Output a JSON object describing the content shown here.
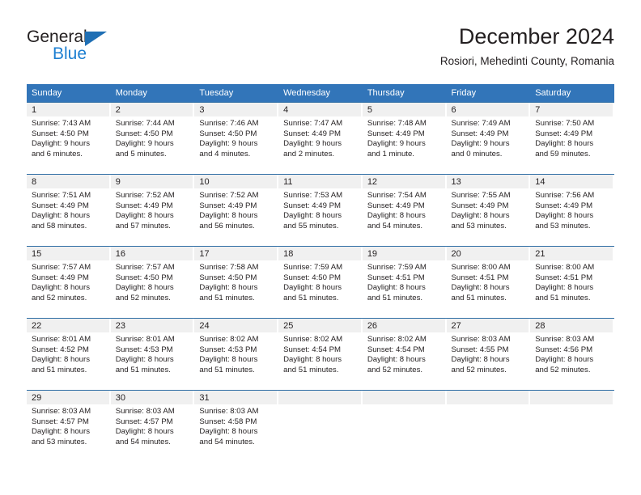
{
  "brand": {
    "name_top": "General",
    "name_bottom": "Blue",
    "accent_color": "#1d7fd1",
    "triangle_color": "#1f6fb4"
  },
  "header": {
    "title": "December 2024",
    "subtitle": "Rosiori, Mehedinti County, Romania"
  },
  "calendar": {
    "header_bg": "#3275b9",
    "row_divider_color": "#2e6da4",
    "daynum_bg": "#f0f0f0",
    "weekdays": [
      "Sunday",
      "Monday",
      "Tuesday",
      "Wednesday",
      "Thursday",
      "Friday",
      "Saturday"
    ],
    "weeks": [
      [
        {
          "day": "1",
          "sunrise": "Sunrise: 7:43 AM",
          "sunset": "Sunset: 4:50 PM",
          "daylight_1": "Daylight: 9 hours",
          "daylight_2": "and 6 minutes."
        },
        {
          "day": "2",
          "sunrise": "Sunrise: 7:44 AM",
          "sunset": "Sunset: 4:50 PM",
          "daylight_1": "Daylight: 9 hours",
          "daylight_2": "and 5 minutes."
        },
        {
          "day": "3",
          "sunrise": "Sunrise: 7:46 AM",
          "sunset": "Sunset: 4:50 PM",
          "daylight_1": "Daylight: 9 hours",
          "daylight_2": "and 4 minutes."
        },
        {
          "day": "4",
          "sunrise": "Sunrise: 7:47 AM",
          "sunset": "Sunset: 4:49 PM",
          "daylight_1": "Daylight: 9 hours",
          "daylight_2": "and 2 minutes."
        },
        {
          "day": "5",
          "sunrise": "Sunrise: 7:48 AM",
          "sunset": "Sunset: 4:49 PM",
          "daylight_1": "Daylight: 9 hours",
          "daylight_2": "and 1 minute."
        },
        {
          "day": "6",
          "sunrise": "Sunrise: 7:49 AM",
          "sunset": "Sunset: 4:49 PM",
          "daylight_1": "Daylight: 9 hours",
          "daylight_2": "and 0 minutes."
        },
        {
          "day": "7",
          "sunrise": "Sunrise: 7:50 AM",
          "sunset": "Sunset: 4:49 PM",
          "daylight_1": "Daylight: 8 hours",
          "daylight_2": "and 59 minutes."
        }
      ],
      [
        {
          "day": "8",
          "sunrise": "Sunrise: 7:51 AM",
          "sunset": "Sunset: 4:49 PM",
          "daylight_1": "Daylight: 8 hours",
          "daylight_2": "and 58 minutes."
        },
        {
          "day": "9",
          "sunrise": "Sunrise: 7:52 AM",
          "sunset": "Sunset: 4:49 PM",
          "daylight_1": "Daylight: 8 hours",
          "daylight_2": "and 57 minutes."
        },
        {
          "day": "10",
          "sunrise": "Sunrise: 7:52 AM",
          "sunset": "Sunset: 4:49 PM",
          "daylight_1": "Daylight: 8 hours",
          "daylight_2": "and 56 minutes."
        },
        {
          "day": "11",
          "sunrise": "Sunrise: 7:53 AM",
          "sunset": "Sunset: 4:49 PM",
          "daylight_1": "Daylight: 8 hours",
          "daylight_2": "and 55 minutes."
        },
        {
          "day": "12",
          "sunrise": "Sunrise: 7:54 AM",
          "sunset": "Sunset: 4:49 PM",
          "daylight_1": "Daylight: 8 hours",
          "daylight_2": "and 54 minutes."
        },
        {
          "day": "13",
          "sunrise": "Sunrise: 7:55 AM",
          "sunset": "Sunset: 4:49 PM",
          "daylight_1": "Daylight: 8 hours",
          "daylight_2": "and 53 minutes."
        },
        {
          "day": "14",
          "sunrise": "Sunrise: 7:56 AM",
          "sunset": "Sunset: 4:49 PM",
          "daylight_1": "Daylight: 8 hours",
          "daylight_2": "and 53 minutes."
        }
      ],
      [
        {
          "day": "15",
          "sunrise": "Sunrise: 7:57 AM",
          "sunset": "Sunset: 4:49 PM",
          "daylight_1": "Daylight: 8 hours",
          "daylight_2": "and 52 minutes."
        },
        {
          "day": "16",
          "sunrise": "Sunrise: 7:57 AM",
          "sunset": "Sunset: 4:50 PM",
          "daylight_1": "Daylight: 8 hours",
          "daylight_2": "and 52 minutes."
        },
        {
          "day": "17",
          "sunrise": "Sunrise: 7:58 AM",
          "sunset": "Sunset: 4:50 PM",
          "daylight_1": "Daylight: 8 hours",
          "daylight_2": "and 51 minutes."
        },
        {
          "day": "18",
          "sunrise": "Sunrise: 7:59 AM",
          "sunset": "Sunset: 4:50 PM",
          "daylight_1": "Daylight: 8 hours",
          "daylight_2": "and 51 minutes."
        },
        {
          "day": "19",
          "sunrise": "Sunrise: 7:59 AM",
          "sunset": "Sunset: 4:51 PM",
          "daylight_1": "Daylight: 8 hours",
          "daylight_2": "and 51 minutes."
        },
        {
          "day": "20",
          "sunrise": "Sunrise: 8:00 AM",
          "sunset": "Sunset: 4:51 PM",
          "daylight_1": "Daylight: 8 hours",
          "daylight_2": "and 51 minutes."
        },
        {
          "day": "21",
          "sunrise": "Sunrise: 8:00 AM",
          "sunset": "Sunset: 4:51 PM",
          "daylight_1": "Daylight: 8 hours",
          "daylight_2": "and 51 minutes."
        }
      ],
      [
        {
          "day": "22",
          "sunrise": "Sunrise: 8:01 AM",
          "sunset": "Sunset: 4:52 PM",
          "daylight_1": "Daylight: 8 hours",
          "daylight_2": "and 51 minutes."
        },
        {
          "day": "23",
          "sunrise": "Sunrise: 8:01 AM",
          "sunset": "Sunset: 4:53 PM",
          "daylight_1": "Daylight: 8 hours",
          "daylight_2": "and 51 minutes."
        },
        {
          "day": "24",
          "sunrise": "Sunrise: 8:02 AM",
          "sunset": "Sunset: 4:53 PM",
          "daylight_1": "Daylight: 8 hours",
          "daylight_2": "and 51 minutes."
        },
        {
          "day": "25",
          "sunrise": "Sunrise: 8:02 AM",
          "sunset": "Sunset: 4:54 PM",
          "daylight_1": "Daylight: 8 hours",
          "daylight_2": "and 51 minutes."
        },
        {
          "day": "26",
          "sunrise": "Sunrise: 8:02 AM",
          "sunset": "Sunset: 4:54 PM",
          "daylight_1": "Daylight: 8 hours",
          "daylight_2": "and 52 minutes."
        },
        {
          "day": "27",
          "sunrise": "Sunrise: 8:03 AM",
          "sunset": "Sunset: 4:55 PM",
          "daylight_1": "Daylight: 8 hours",
          "daylight_2": "and 52 minutes."
        },
        {
          "day": "28",
          "sunrise": "Sunrise: 8:03 AM",
          "sunset": "Sunset: 4:56 PM",
          "daylight_1": "Daylight: 8 hours",
          "daylight_2": "and 52 minutes."
        }
      ],
      [
        {
          "day": "29",
          "sunrise": "Sunrise: 8:03 AM",
          "sunset": "Sunset: 4:57 PM",
          "daylight_1": "Daylight: 8 hours",
          "daylight_2": "and 53 minutes."
        },
        {
          "day": "30",
          "sunrise": "Sunrise: 8:03 AM",
          "sunset": "Sunset: 4:57 PM",
          "daylight_1": "Daylight: 8 hours",
          "daylight_2": "and 54 minutes."
        },
        {
          "day": "31",
          "sunrise": "Sunrise: 8:03 AM",
          "sunset": "Sunset: 4:58 PM",
          "daylight_1": "Daylight: 8 hours",
          "daylight_2": "and 54 minutes."
        },
        {
          "day": "",
          "sunrise": "",
          "sunset": "",
          "daylight_1": "",
          "daylight_2": ""
        },
        {
          "day": "",
          "sunrise": "",
          "sunset": "",
          "daylight_1": "",
          "daylight_2": ""
        },
        {
          "day": "",
          "sunrise": "",
          "sunset": "",
          "daylight_1": "",
          "daylight_2": ""
        },
        {
          "day": "",
          "sunrise": "",
          "sunset": "",
          "daylight_1": "",
          "daylight_2": ""
        }
      ]
    ]
  }
}
